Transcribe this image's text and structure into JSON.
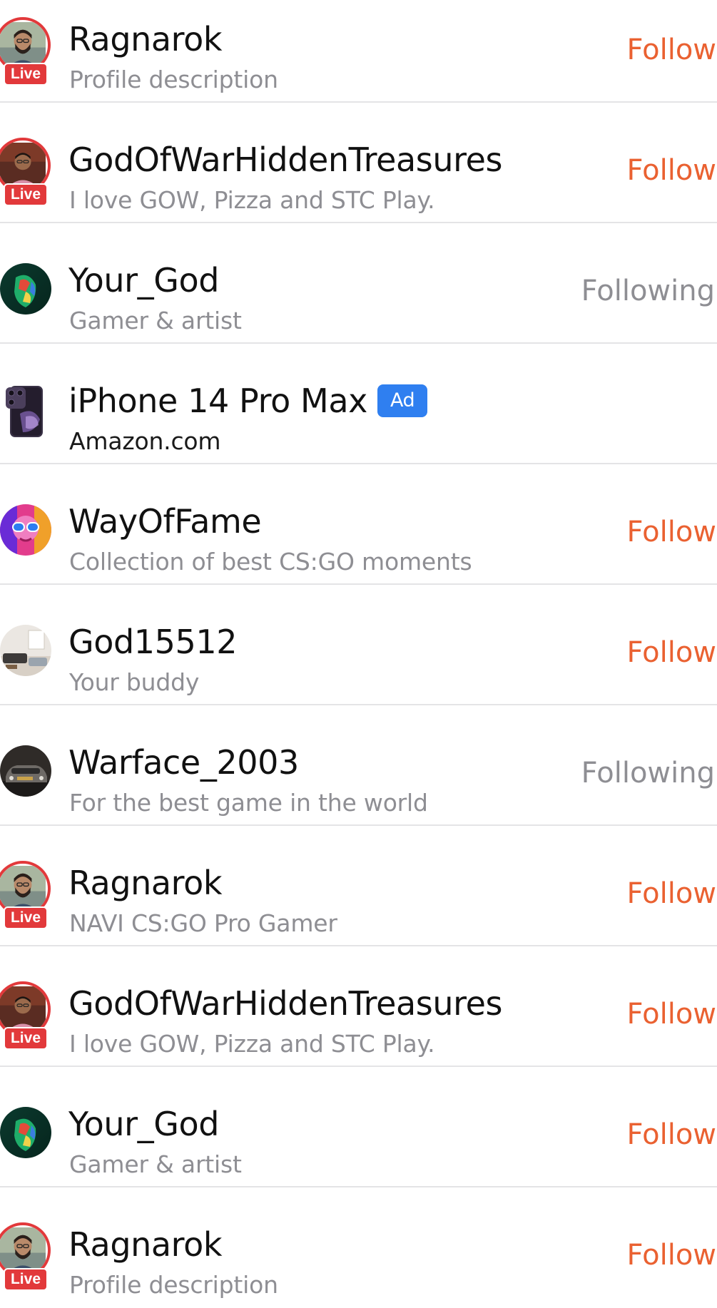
{
  "colors": {
    "follow_accent": "#ea6131",
    "following_gray": "#8e8e93",
    "live_red": "#e2393b",
    "ad_blue": "#2f7ff0",
    "divider": "#e4e4e6"
  },
  "rows": [
    {
      "type": "user",
      "name": "Ragnarok",
      "description": "Profile description",
      "live": true,
      "live_label": "Live",
      "action": "Follow",
      "following": false,
      "avatar": "man-beard-avatar"
    },
    {
      "type": "user",
      "name": "GodOfWarHiddenTreasures",
      "description": "I love GOW, Pizza and STC Play.",
      "live": true,
      "live_label": "Live",
      "action": "Follow",
      "following": false,
      "avatar": "man-pink-shirt-avatar"
    },
    {
      "type": "user",
      "name": "Your_God",
      "description": "Gamer & artist",
      "live": false,
      "action": "Following",
      "following": true,
      "avatar": "neon-face-avatar"
    },
    {
      "type": "ad",
      "name": "iPhone 14 Pro Max",
      "ad_label": "Ad",
      "description": "Amazon.com",
      "avatar": "iphone-product-image"
    },
    {
      "type": "user",
      "name": "WayOfFame",
      "description": "Collection of best CS:GO moments",
      "live": false,
      "action": "Follow",
      "following": false,
      "avatar": "colorful-sunglasses-avatar"
    },
    {
      "type": "user",
      "name": "God15512",
      "description": "Your buddy",
      "live": false,
      "action": "Follow",
      "following": false,
      "avatar": "room-interior-avatar"
    },
    {
      "type": "user",
      "name": "Warface_2003",
      "description": "For the best game in the world",
      "live": false,
      "action": "Following",
      "following": true,
      "avatar": "car-avatar"
    },
    {
      "type": "user",
      "name": "Ragnarok",
      "description": "NAVI CS:GO Pro Gamer",
      "live": true,
      "live_label": "Live",
      "action": "Follow",
      "following": false,
      "avatar": "man-beard-avatar"
    },
    {
      "type": "user",
      "name": "GodOfWarHiddenTreasures",
      "description": "I love GOW, Pizza and STC Play.",
      "live": true,
      "live_label": "Live",
      "action": "Follow",
      "following": false,
      "avatar": "man-pink-shirt-avatar"
    },
    {
      "type": "user",
      "name": "Your_God",
      "description": "Gamer & artist",
      "live": false,
      "action": "Follow",
      "following": false,
      "avatar": "neon-face-avatar"
    },
    {
      "type": "user",
      "name": "Ragnarok",
      "description": "Profile description",
      "live": true,
      "live_label": "Live",
      "action": "Follow",
      "following": false,
      "avatar": "man-beard-avatar"
    }
  ]
}
